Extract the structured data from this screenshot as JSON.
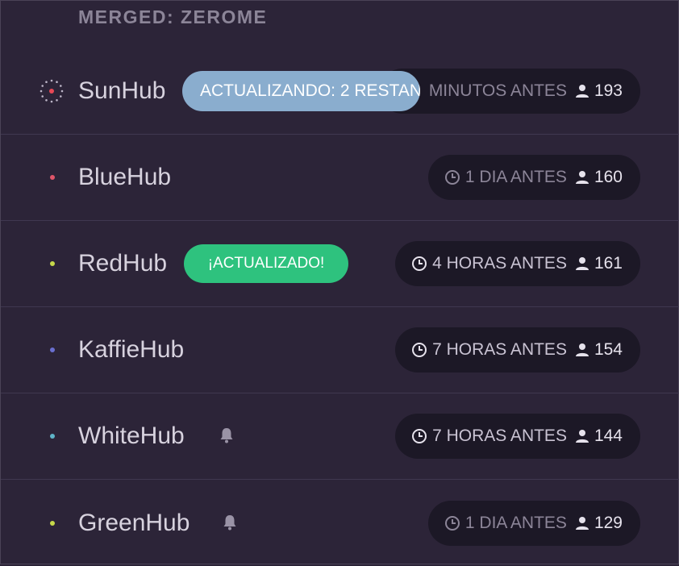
{
  "section": {
    "title": "MERGED: ZEROME"
  },
  "hubs": [
    {
      "name": "SunHub",
      "dot_color": "#e74856",
      "status": "updating",
      "updating_label": "ACTUALIZANDO: 2 RESTAN",
      "time": "MINUTOS ANTES",
      "users": "193",
      "bell": false
    },
    {
      "name": "BlueHub",
      "dot_color": "#e0566a",
      "status": "",
      "time": "1 DIA ANTES",
      "users": "160",
      "bell": false
    },
    {
      "name": "RedHub",
      "dot_color": "#c6d84a",
      "status": "updated",
      "status_label": "¡ACTUALIZADO!",
      "time": "4 HORAS ANTES",
      "users": "161",
      "bell": false
    },
    {
      "name": "KaffieHub",
      "dot_color": "#6a6fd0",
      "status": "",
      "time": "7 HORAS ANTES",
      "users": "154",
      "bell": false
    },
    {
      "name": "WhiteHub",
      "dot_color": "#5fb4c8",
      "status": "",
      "time": "7 HORAS ANTES",
      "users": "144",
      "bell": true
    },
    {
      "name": "GreenHub",
      "dot_color": "#c6d84a",
      "status": "",
      "time": "1 DIA ANTES",
      "users": "129",
      "bell": true
    }
  ],
  "icons": {
    "clock": "clock-icon",
    "user": "user-icon",
    "bell": "bell-icon",
    "spinner": "loading-spinner-icon"
  },
  "colors": {
    "background": "#2c2438",
    "pill_background": "#1c1826",
    "updated_badge": "#2ec27e",
    "updating_badge": "#8aadce"
  }
}
